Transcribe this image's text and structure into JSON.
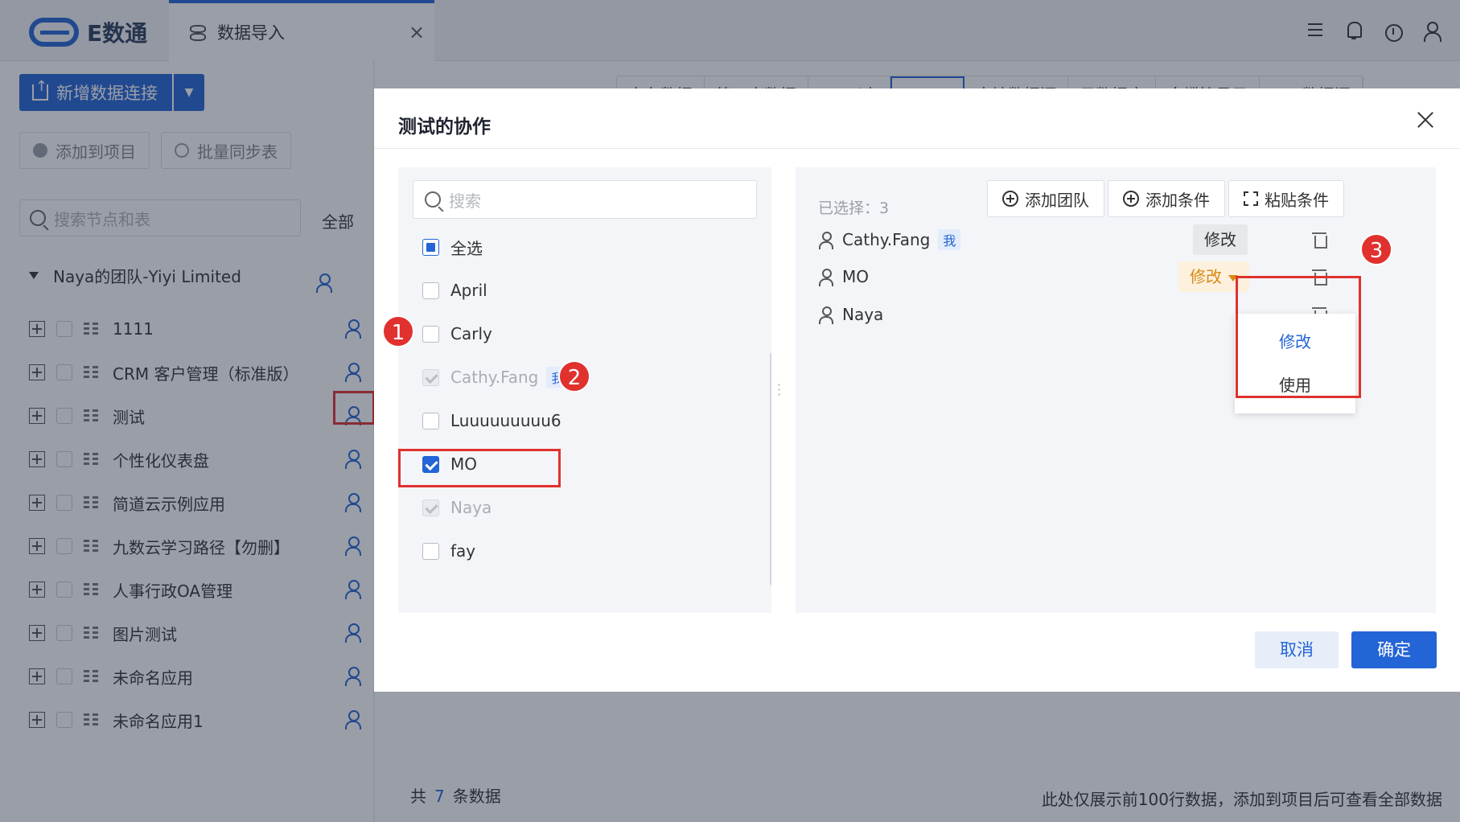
{
  "app": {
    "logo_text": "E数通"
  },
  "tab": {
    "label": "数据导入"
  },
  "left": {
    "new_connection": "新增数据连接",
    "add_to_project": "添加到项目",
    "batch_sync": "批量同步表",
    "search_placeholder": "搜索节点和表",
    "filter": "全部",
    "team": "Naya的团队-Yiyi Limited",
    "tree": [
      "1111",
      "CRM 客户管理（标准版）",
      "测试",
      "个性化仪表盘",
      "简道云示例应用",
      "九数云学习路径【勿删】",
      "人事行政OA管理",
      "图片测试",
      "未命名应用",
      "未命名应用1"
    ]
  },
  "source_tabs": [
    "自有数据",
    "第三方数据",
    "Excel表",
    "简道云",
    "本地数据源",
    "云数据库",
    "金蝶管易云",
    "ERP数据源"
  ],
  "footer": {
    "prefix": "共",
    "count": "7",
    "suffix": "条数据",
    "note": "此处仅展示前100行数据，添加到项目后可查看全部数据"
  },
  "modal": {
    "title": "测试的协作",
    "search_placeholder": "搜索",
    "select_all": "全选",
    "me_tag": "我",
    "members": [
      {
        "name": "April",
        "state": "unchecked"
      },
      {
        "name": "Carly",
        "state": "unchecked"
      },
      {
        "name": "Cathy.Fang",
        "state": "disabled",
        "me": true
      },
      {
        "name": "Luuuuuuuuu6",
        "state": "unchecked"
      },
      {
        "name": "MO",
        "state": "checked"
      },
      {
        "name": "Naya",
        "state": "disabled"
      },
      {
        "name": "fay",
        "state": "unchecked"
      }
    ],
    "selected_label": "已选择：3",
    "add_team": "添加团队",
    "add_condition": "添加条件",
    "paste_condition": "粘贴条件",
    "selected": [
      {
        "name": "Cathy.Fang",
        "me": true,
        "permission": "修改"
      },
      {
        "name": "MO",
        "permission": "修改"
      },
      {
        "name": "Naya",
        "permission": ""
      }
    ],
    "dropdown_options": [
      "修改",
      "使用"
    ],
    "cancel": "取消",
    "confirm": "确定"
  },
  "annotations": [
    "1",
    "2",
    "3"
  ],
  "colors": {
    "primary": "#2364d6",
    "highlight": "#e0312e",
    "permission_orange": "#d98a14"
  }
}
